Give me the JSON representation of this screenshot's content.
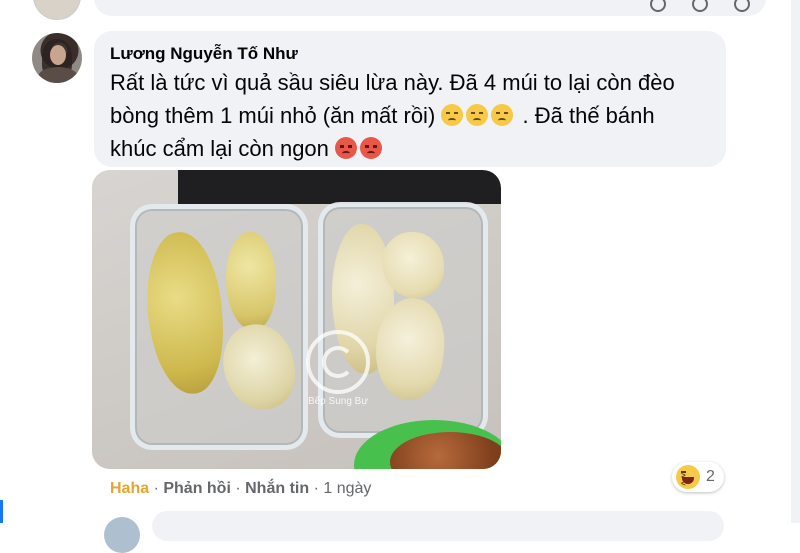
{
  "comment": {
    "author": "Lương Nguyễn Tố Như",
    "text_line1": "Rất là tức vì quả sầu siêu lừa này. Đã 4 múi to lại còn đèo",
    "text_line2_before_emojis": "bòng thêm 1 múi nhỏ (ăn mất rồi)",
    "text_line2_after_emojis": " . Đã thế bánh",
    "text_line3": "khúc cẩm lại còn ngon",
    "sad_emojis": [
      "sad-relieved-face-icon",
      "sad-relieved-face-icon",
      "sad-relieved-face-icon"
    ],
    "angry_emojis": [
      "angry-face-icon",
      "angry-face-icon"
    ]
  },
  "photo": {
    "watermark_text": "Bếp Sung Bự"
  },
  "actions": {
    "reaction": "Haha",
    "reply": "Phản hồi",
    "message": "Nhắn tin",
    "time": "1 ngày",
    "separator": " · "
  },
  "reactions": {
    "icon": "haha-icon",
    "count": "2"
  },
  "colors": {
    "bubble": "#f0f2f5",
    "haha_accent": "#e8a530",
    "secondary_text": "#65676b",
    "brand": "#1877f2"
  }
}
